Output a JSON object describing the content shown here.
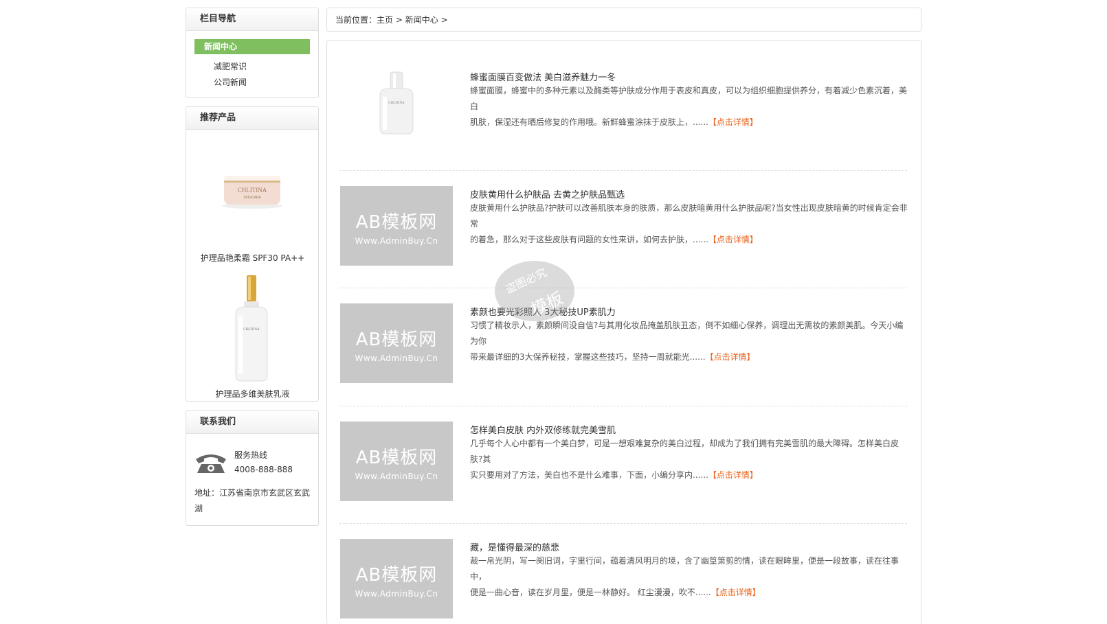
{
  "nav": {
    "title": "栏目导航",
    "active": "新闻中心",
    "items": [
      "减肥常识",
      "公司新闻"
    ]
  },
  "products": {
    "title": "推荐产品",
    "items": [
      {
        "name": "护理品艳柔霜 SPF30 PA++",
        "jar_label": "CHLITINA",
        "jar_sub": "SKINCARE"
      },
      {
        "name": "护理品多维美肤乳液",
        "bottle_label": "CHLITINA"
      }
    ]
  },
  "contact": {
    "title": "联系我们",
    "hotline_label": "服务热线",
    "hotline": "4008-888-888",
    "address": "地址：江苏省南京市玄武区玄武湖"
  },
  "breadcrumb": {
    "prefix": "当前位置：",
    "home": "主页",
    "sep": ">",
    "current": "新闻中心",
    "trail": ">"
  },
  "placeholder": {
    "big": "AB模板网",
    "small": "Www.AdminBuy.Cn"
  },
  "first_thumb_label": "CHLITINA",
  "watermark": {
    "top": "盗图必究",
    "bottom": "模板"
  },
  "news": [
    {
      "title": "蜂蜜面膜百变做法 美白滋养魅力一冬",
      "line1": "蜂蜜面膜，蜂蜜中的多种元素以及酶类等护肤成分作用于表皮和真皮，可以为组织细胞提供养分，有着减少色素沉着，美白",
      "line2": "肌肤，保湿还有晒后修复的作用哦。新鲜蜂蜜涂抹于皮肤上，......",
      "more": "【点击详情】"
    },
    {
      "title": "皮肤黄用什么护肤品 去黄之护肤品甄选",
      "line1": "皮肤黄用什么护肤品?护肤可以改善肌肤本身的肤质，那么皮肤暗黄用什么护肤品呢?当女性出现皮肤暗黄的时候肯定会非常",
      "line2": "的着急，那么对于这些皮肤有问题的女性来讲，如何去护肤，......",
      "more": "【点击详情】"
    },
    {
      "title": "素颜也要光彩照人 3大秘技UP素肌力",
      "line1": "习惯了精妆示人，素颜瞬间没自信?与其用化妆品掩盖肌肤丑态，倒不如细心保养，调理出无需妆的素颜美肌。今天小编为你",
      "line2": "带来最详细的3大保养秘技，掌握这些技巧，坚持一周就能光......",
      "more": "【点击详情】"
    },
    {
      "title": "怎样美白皮肤 内外双修练就完美雪肌",
      "line1": "几乎每个人心中都有一个美白梦，可是一想艰难复杂的美白过程，却成为了我们拥有完美雪肌的最大障碍。怎样美白皮肤?其",
      "line2": "实只要用对了方法，美白也不是什么难事，下面，小编分享内......",
      "more": "【点击详情】"
    },
    {
      "title": "藏，是懂得最深的慈悲",
      "line1": "裁一帛光阴，写一阕旧词，字里行间，蕴着清风明月的境，含了幽篁箫剪的情，读在眼眸里，便是一段故事，读在往事中，",
      "line2": "便是一曲心音，读在岁月里，便是一林静好。 红尘漫漫，吹不......",
      "more": "【点击详情】"
    }
  ]
}
